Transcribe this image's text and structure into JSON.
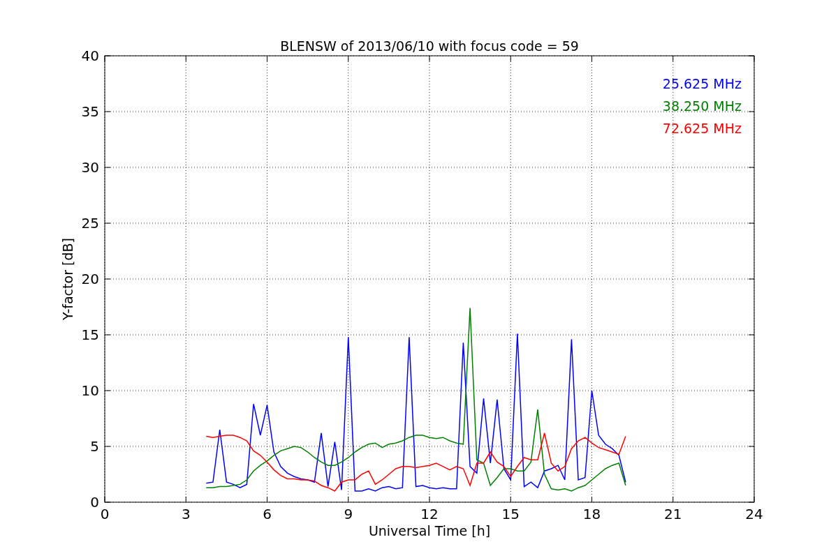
{
  "figure": {
    "chart_data": {
      "type": "line",
      "title": "BLENSW of 2013/06/10 with focus code = 59",
      "xlabel": "Universal Time [h]",
      "ylabel": "Y-factor [dB]",
      "x": [
        3.75,
        4.0,
        4.25,
        4.5,
        4.75,
        5.0,
        5.25,
        5.5,
        5.75,
        6.0,
        6.25,
        6.5,
        6.75,
        7.0,
        7.25,
        7.5,
        7.75,
        8.0,
        8.25,
        8.5,
        8.75,
        9.0,
        9.25,
        9.5,
        9.75,
        10.0,
        10.25,
        10.5,
        10.75,
        11.0,
        11.25,
        11.5,
        11.75,
        12.0,
        12.25,
        12.5,
        12.75,
        13.0,
        13.25,
        13.5,
        13.75,
        14.0,
        14.25,
        14.5,
        14.75,
        15.0,
        15.25,
        15.5,
        15.75,
        16.0,
        16.25,
        16.5,
        16.75,
        17.0,
        17.25,
        17.5,
        17.75,
        18.0,
        18.25,
        18.5,
        18.75,
        19.0,
        19.25
      ],
      "series": [
        {
          "name": "25.625 MHz",
          "color": "#0000ff",
          "values": [
            1.7,
            1.8,
            6.5,
            1.8,
            1.6,
            1.3,
            1.6,
            8.8,
            6.0,
            8.7,
            4.5,
            3.2,
            2.6,
            2.3,
            2.1,
            2.0,
            1.8,
            6.2,
            1.4,
            5.4,
            1.1,
            14.8,
            1.0,
            1.0,
            1.2,
            1.0,
            1.3,
            1.4,
            1.2,
            1.3,
            14.8,
            1.4,
            1.5,
            1.3,
            1.2,
            1.3,
            1.2,
            1.2,
            14.3,
            3.2,
            2.6,
            9.3,
            3.5,
            9.2,
            3.0,
            2.0,
            15.1,
            1.4,
            1.8,
            1.3,
            2.8,
            3.0,
            3.3,
            2.0,
            14.6,
            2.0,
            2.2,
            10.0,
            6.0,
            5.2,
            4.8,
            4.2,
            1.8
          ]
        },
        {
          "name": "38.250 MHz",
          "color": "#008000",
          "values": [
            1.3,
            1.3,
            1.4,
            1.4,
            1.5,
            1.6,
            2.0,
            2.8,
            3.3,
            3.7,
            4.2,
            4.6,
            4.8,
            5.0,
            4.9,
            4.5,
            4.0,
            3.6,
            3.3,
            3.3,
            3.6,
            4.0,
            4.5,
            4.9,
            5.2,
            5.3,
            4.9,
            5.2,
            5.3,
            5.5,
            5.8,
            6.0,
            6.0,
            5.8,
            5.7,
            5.8,
            5.5,
            5.3,
            5.2,
            17.4,
            3.8,
            3.5,
            1.5,
            2.2,
            3.0,
            3.0,
            2.8,
            2.8,
            3.6,
            8.3,
            2.5,
            1.2,
            1.1,
            1.2,
            1.0,
            1.3,
            1.5,
            2.0,
            2.5,
            3.0,
            3.3,
            3.5,
            1.5
          ]
        },
        {
          "name": "72.625 MHz",
          "color": "#ff0000",
          "values": [
            5.9,
            5.8,
            5.9,
            6.0,
            6.0,
            5.8,
            5.5,
            4.6,
            4.2,
            3.6,
            2.9,
            2.4,
            2.1,
            2.1,
            2.0,
            2.0,
            1.9,
            1.5,
            1.3,
            1.0,
            1.8,
            2.0,
            2.0,
            2.5,
            2.8,
            1.6,
            2.0,
            2.5,
            3.0,
            3.2,
            3.2,
            3.1,
            3.2,
            3.3,
            3.5,
            3.2,
            2.9,
            3.2,
            3.0,
            1.5,
            3.5,
            3.5,
            4.5,
            3.6,
            3.2,
            2.3,
            3.2,
            4.0,
            3.8,
            3.8,
            6.2,
            3.5,
            2.8,
            3.2,
            4.8,
            5.5,
            5.8,
            5.3,
            4.9,
            4.7,
            4.5,
            4.3,
            5.9
          ]
        }
      ],
      "xlim": [
        0,
        24
      ],
      "ylim": [
        0,
        40
      ],
      "xticks": [
        0,
        3,
        6,
        9,
        12,
        15,
        18,
        21,
        24
      ],
      "yticks": [
        0,
        5,
        10,
        15,
        20,
        25,
        30,
        35,
        40
      ],
      "grid": true
    }
  }
}
